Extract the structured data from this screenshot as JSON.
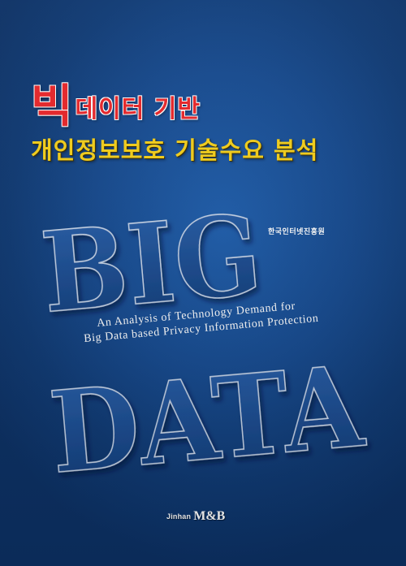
{
  "title": {
    "line1_big": "빅",
    "line1_rest": "데이터 기반",
    "line2": "개인정보보호 기술수요 분석"
  },
  "graphic": {
    "word_top": "BIG",
    "word_bottom": "DATA"
  },
  "organization": "한국인터넷진흥원",
  "subtitle": {
    "line1": "An Analysis of Technology Demand for",
    "line2": "Big Data based Privacy Information Protection"
  },
  "publisher": {
    "name_small": "Jinhan",
    "name_large": "M&B"
  },
  "colors": {
    "background": "#164a8f",
    "title_red": "#e8262a",
    "title_yellow": "#f6d11b",
    "letter_fill": "#1d4f95",
    "letter_outline": "#c9d7ea"
  }
}
